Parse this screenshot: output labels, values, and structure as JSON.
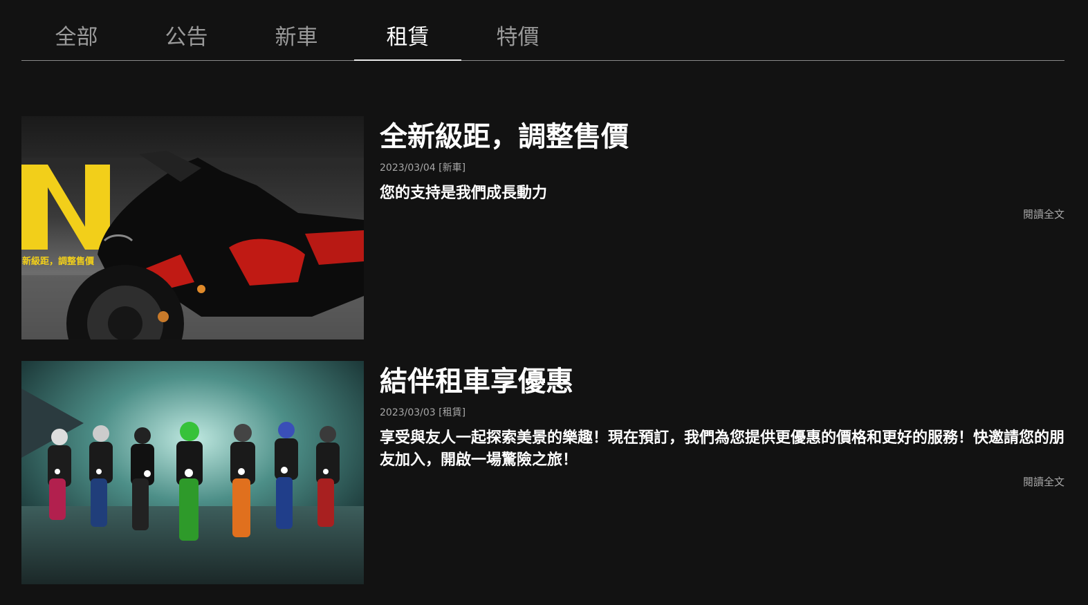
{
  "tabs": [
    {
      "label": "全部"
    },
    {
      "label": "公告"
    },
    {
      "label": "新車"
    },
    {
      "label": "租賃"
    },
    {
      "label": "特價"
    }
  ],
  "active_tab": "租賃",
  "articles": [
    {
      "title": "全新級距，調整售價",
      "meta": "2023/03/04 [新車]",
      "excerpt": "您的支持是我們成長動力",
      "read_more": "閱讀全文",
      "image_caption": "新級距，調整售價",
      "image_letter": "N"
    },
    {
      "title": "結伴租車享優惠",
      "meta": "2023/03/03 [租賃]",
      "excerpt": "享受與友人一起探索美景的樂趣！現在預訂，我們為您提供更優惠的價格和更好的服務！快邀請您的朋友加入，開啟一場驚險之旅！",
      "read_more": "閱讀全文"
    }
  ],
  "colors": {
    "background": "#121212",
    "accent_yellow": "#f2cf1a",
    "brand_red": "#d0201a"
  }
}
